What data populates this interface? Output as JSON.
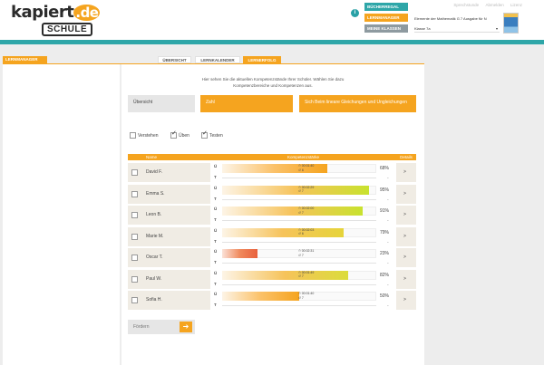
{
  "header": {
    "logo_top": "kapiert",
    "logo_dot": ".de",
    "logo_bottom": "SCHULE",
    "links": [
      "Sprechstunde",
      "Abmelden",
      "Lizenz"
    ],
    "info_icon": "i",
    "buttons": [
      {
        "label": "BÜCHERREGAL",
        "color": "#2ea6a8"
      },
      {
        "label": "LERNMANAGER",
        "color": "#f5a41f"
      },
      {
        "label": "MEINE KLASSEN",
        "color": "#8e9aa0"
      }
    ],
    "book_title": "Elemente der Mathematik G 7 Ausgabe für N",
    "class_value": "Klasse 7a"
  },
  "nav": {
    "lernmanager": "LERNMANAGER",
    "tabs": [
      "ÜBERSICHT",
      "LERNKALENDER",
      "LERNERFOLG"
    ],
    "active_tab": "LERNERFOLG"
  },
  "intro": "Hier sehen Sie die aktuellen Kompetenzstände Ihrer Schüler. Wählen Sie dazu Kompetenzbereiche und Kompetenzen aus.",
  "filters": {
    "overview": "Übersicht",
    "area": "Zahl",
    "competence": "Sich Beim lineare Gleichungen und Ungleichungen"
  },
  "checkboxes": [
    {
      "label": "Verstehen",
      "checked": false
    },
    {
      "label": "Üben",
      "checked": true
    },
    {
      "label": "Testen",
      "checked": true
    }
  ],
  "table_headers": {
    "name": "Name",
    "competence": "Kompetenzstärke",
    "details": "Details"
  },
  "row_labels": {
    "u": "Ü",
    "t": "T"
  },
  "students": [
    {
      "name": "David F.",
      "pct": "68%",
      "level": 0.68,
      "time": "⏱ 00:01:40",
      "count": "↺ 6",
      "grad": "linear-gradient(90deg,#fdf4e6,#fbc168,#f5a41f)"
    },
    {
      "name": "Emma S.",
      "pct": "95%",
      "level": 0.95,
      "time": "⏱ 00:02:29",
      "count": "↺ 7",
      "grad": "linear-gradient(90deg,#fdf4e6,#f6c35a,#c8e22e)"
    },
    {
      "name": "Leon B.",
      "pct": "91%",
      "level": 0.91,
      "time": "⏱ 00:02:00",
      "count": "↺ 7",
      "grad": "linear-gradient(90deg,#fdf4e6,#f6c35a,#c8e22e)"
    },
    {
      "name": "Marie M.",
      "pct": "79%",
      "level": 0.79,
      "time": "⏱ 00:02:03",
      "count": "↺ 6",
      "grad": "linear-gradient(90deg,#fdf4e6,#f6c35a,#e6d43a)"
    },
    {
      "name": "Oscar T.",
      "pct": "23%",
      "level": 0.23,
      "time": "⏱ 00:02:31",
      "count": "↺ 7",
      "grad": "linear-gradient(90deg,#fbe2d8,#f08a5d,#e8603c)"
    },
    {
      "name": "Paul W.",
      "pct": "82%",
      "level": 0.82,
      "time": "⏱ 00:01:49",
      "count": "↺ 7",
      "grad": "linear-gradient(90deg,#fdf4e6,#f6c35a,#dbdc3a)"
    },
    {
      "name": "Sofia H.",
      "pct": "50%",
      "level": 0.5,
      "time": "⏱ 00:01:40",
      "count": "↺ 7",
      "grad": "linear-gradient(90deg,#fdf4e6,#fbc168,#f5a41f)"
    }
  ],
  "dash": "-",
  "detail_arrow": ">",
  "forward": {
    "label": "Fördern",
    "arrow": "➔"
  }
}
